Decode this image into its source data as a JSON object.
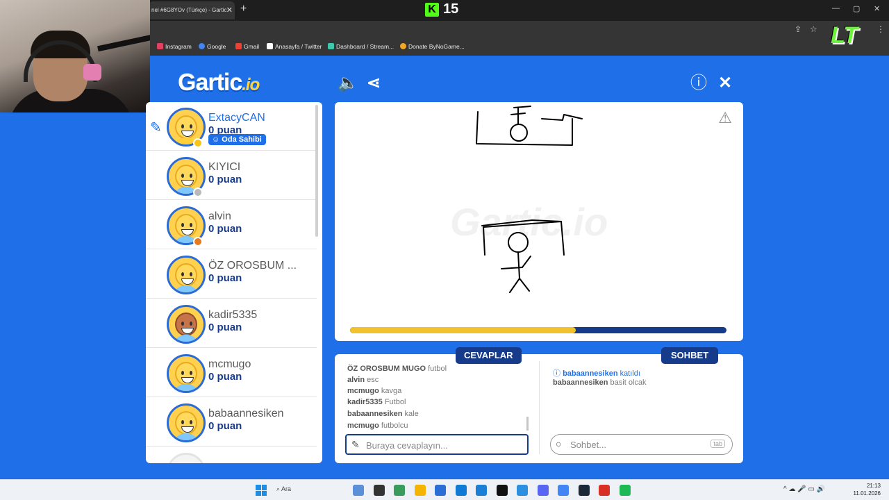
{
  "browser": {
    "tab_title": "nel #6G8YOv (Türkçe) - Gartic",
    "tab_close": "✕",
    "new_tab": "+",
    "kick_logo_letter": "K",
    "viewer_count": "15",
    "window_controls": [
      "—",
      "▢",
      "✕"
    ],
    "bookmarks": [
      {
        "label": "Instagram",
        "color": "#e4405f"
      },
      {
        "label": "Google",
        "color": "#4285f4"
      },
      {
        "label": "Gmail",
        "color": "#ea4335"
      },
      {
        "label": "Anasayfa / Twitter",
        "color": "#ffffff"
      },
      {
        "label": "Dashboard / Stream...",
        "color": "#3ec7ab"
      },
      {
        "label": "Donate ByNoGame...",
        "color": "#f5a623"
      }
    ]
  },
  "header": {
    "logo_main": "Gartic",
    "logo_suffix": ".io",
    "sound_icon": "🔈",
    "share_icon": "⋖",
    "info_icon": "ⓘ",
    "close_icon": "✕"
  },
  "players": [
    {
      "name": "ExtacyCAN",
      "points": "0 puan",
      "owner": true,
      "drawing": true,
      "status_color": "#f5c518",
      "shirt": "#ffcf3a"
    },
    {
      "name": "KIYICI",
      "points": "0 puan",
      "status_color": "#b9b9b9",
      "shirt": "#7ec8ff"
    },
    {
      "name": "alvin",
      "points": "0 puan",
      "status_color": "#e57a1e",
      "shirt": "#7ec8ff"
    },
    {
      "name": "ÖZ OROSBUM ...",
      "points": "0 puan",
      "shirt": "#7ec8ff"
    },
    {
      "name": "kadir5335",
      "points": "0 puan",
      "shirt": "#7ec8ff"
    },
    {
      "name": "mcmugo",
      "points": "0 puan",
      "shirt": "#7ec8ff"
    },
    {
      "name": "babaannesiken",
      "points": "0 puan",
      "shirt": "#7ec8ff"
    }
  ],
  "owner_badge": "Oda Sahibi",
  "owner_badge_icon": "☺",
  "draw_indicator_icon": "✎",
  "canvas": {
    "watermark": "Gartic.io",
    "warning_icon": "⚠",
    "time_remaining_fraction": 0.6
  },
  "answers": {
    "title": "CEVAPLAR",
    "items": [
      {
        "user": "ÖZ OROSBUM MUGO",
        "text": "futbol"
      },
      {
        "user": "alvin",
        "text": "esc"
      },
      {
        "user": "mcmugo",
        "text": "kavga"
      },
      {
        "user": "kadir5335",
        "text": "Futbol"
      },
      {
        "user": "babaannesiken",
        "text": "kale"
      },
      {
        "user": "mcmugo",
        "text": "futbolcu"
      }
    ],
    "input_placeholder": "Buraya cevaplayın...",
    "input_icon": "✎"
  },
  "chat": {
    "title": "SOHBET",
    "messages": [
      {
        "user": "babaannesiken",
        "text": "katıldı",
        "system": true
      },
      {
        "user": "babaannesiken",
        "text": "basit olcak",
        "system": false
      }
    ],
    "system_icon": "ⓘ",
    "input_placeholder": "Sohbet...",
    "input_icon": "○",
    "tab_hint": "tab"
  },
  "taskbar": {
    "search_label": "Ara",
    "tray_icons": "^  ☁  🎤  ▭  🔊",
    "time": "21:13",
    "date": "11.01.2026",
    "apps": [
      "#5b8fd8",
      "#333333",
      "#3a9c5c",
      "#f4b400",
      "#2b6fd6",
      "#0f7bd4",
      "#1c7fd6",
      "#111111",
      "#2d8fe0",
      "#5865f2",
      "#4285f4",
      "#1b2838",
      "#d93025",
      "#1db954"
    ]
  }
}
